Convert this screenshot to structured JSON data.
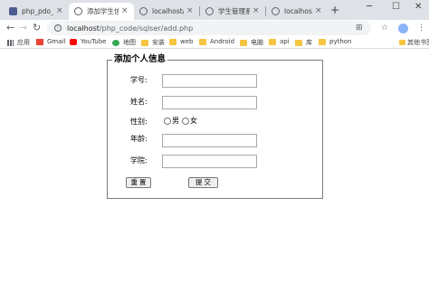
{
  "tabs": [
    {
      "title": "php_pdo_sql",
      "close": "×"
    },
    {
      "title": "添加学生信息",
      "close": "×"
    },
    {
      "title": "localhost/php",
      "close": "×"
    },
    {
      "title": "学生管理系统",
      "close": "×"
    },
    {
      "title": "localhost/php",
      "close": "×"
    }
  ],
  "new_tab": "+",
  "window_controls": {
    "minimize": "─",
    "maximize": "☐",
    "close": "✕"
  },
  "toolbar": {
    "back": "←",
    "forward": "→",
    "reload": "↻",
    "url_host": "localhost",
    "url_path": "/php_code/sqlser/add.php",
    "translate": "⊞",
    "star": "☆",
    "menu": "⋮"
  },
  "bookmarks": [
    {
      "label": "应用",
      "icon": "apps-icon"
    },
    {
      "label": "Gmail",
      "icon": "gmail-icon"
    },
    {
      "label": "YouTube",
      "icon": "youtube-icon"
    },
    {
      "label": "地图",
      "icon": "maps-icon"
    },
    {
      "label": "安装",
      "icon": "folder-icon"
    },
    {
      "label": "web",
      "icon": "folder-icon"
    },
    {
      "label": "Android",
      "icon": "folder-icon"
    },
    {
      "label": "电脑",
      "icon": "folder-icon"
    },
    {
      "label": "api",
      "icon": "folder-icon"
    },
    {
      "label": "库",
      "icon": "folder-icon"
    },
    {
      "label": "python",
      "icon": "folder-icon"
    }
  ],
  "other_bookmarks": "其他书签",
  "form": {
    "legend": "添加个人信息",
    "student_id_label": "学号:",
    "student_id_value": "",
    "name_label": "姓名:",
    "name_value": "",
    "gender_label": "性别:",
    "gender_options": [
      "男",
      "女"
    ],
    "age_label": "年龄:",
    "age_value": "",
    "college_label": "学院:",
    "college_value": "",
    "reset_label": "重 置",
    "submit_label": "提 交"
  }
}
